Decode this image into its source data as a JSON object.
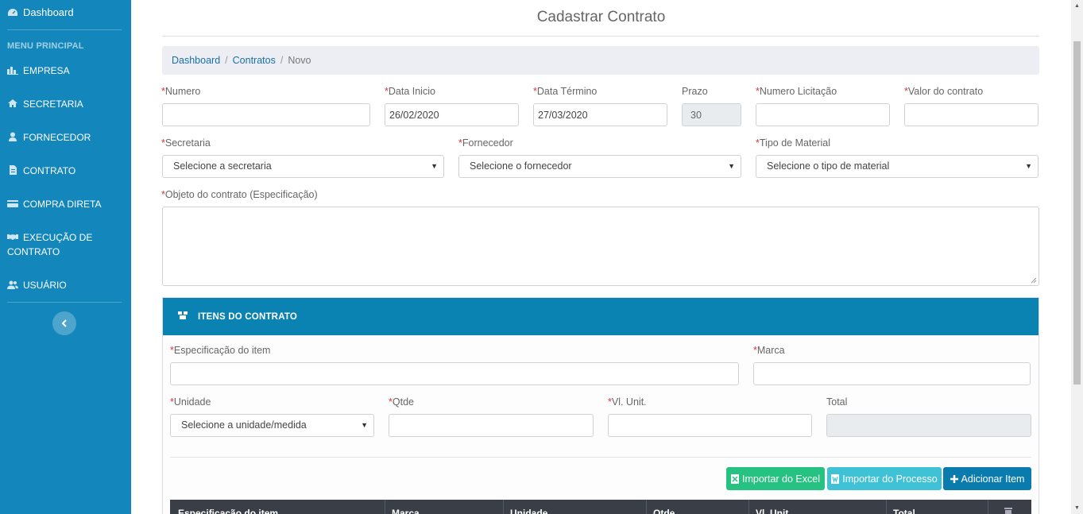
{
  "sidebar": {
    "dashboard": "Dashboard",
    "menu_header": "MENU PRINCIPAL",
    "items": [
      {
        "label": "EMPRESA",
        "icon": "bar-chart-icon"
      },
      {
        "label": "SECRETARIA",
        "icon": "home-icon"
      },
      {
        "label": "FORNECEDOR",
        "icon": "user-icon"
      },
      {
        "label": "CONTRATO",
        "icon": "document-icon"
      },
      {
        "label": "COMPRA DIRETA",
        "icon": "card-icon"
      },
      {
        "label": "EXECUÇÃO DE CONTRATO",
        "icon": "handshake-icon"
      },
      {
        "label": "USUÁRIO",
        "icon": "users-icon"
      }
    ]
  },
  "page": {
    "title": "Cadastrar Contrato"
  },
  "breadcrumb": {
    "dashboard": "Dashboard",
    "sep1": "/",
    "contratos": "Contratos",
    "sep2": "/",
    "current": "Novo"
  },
  "form": {
    "required_mark": "*",
    "numero": {
      "label": "Numero",
      "value": ""
    },
    "data_inicio": {
      "label": "Data Inicio",
      "value": "26/02/2020"
    },
    "data_termino": {
      "label": "Data Término",
      "value": "27/03/2020"
    },
    "prazo": {
      "label": "Prazo",
      "value": "30"
    },
    "numero_licitacao": {
      "label": "Numero Licitação",
      "value": ""
    },
    "valor_contrato": {
      "label": "Valor do contrato",
      "value": ""
    },
    "secretaria": {
      "label": "Secretaria",
      "selected": "Selecione a secretaria"
    },
    "fornecedor": {
      "label": "Fornecedor",
      "selected": "Selecione o fornecedor"
    },
    "tipo_material": {
      "label": "Tipo de Material",
      "selected": "Selecione o tipo de material"
    },
    "objeto": {
      "label": "Objeto do contrato (Especificação)",
      "value": ""
    }
  },
  "itens": {
    "header": "ITENS DO CONTRATO",
    "especificacao": {
      "label": "Especificação do item",
      "value": ""
    },
    "marca": {
      "label": "Marca",
      "value": ""
    },
    "unidade": {
      "label": "Unidade",
      "selected": "Selecione a unidade/medida"
    },
    "qtde": {
      "label": "Qtde",
      "value": ""
    },
    "vl_unit": {
      "label": "Vl. Unit.",
      "value": ""
    },
    "total": {
      "label": "Total",
      "value": ""
    },
    "buttons": {
      "importar_excel": "Importar do Excel",
      "importar_processo": "Importar do Processo",
      "adicionar_item": "Adicionar Item"
    },
    "table_headers": [
      "Especificação do item",
      "Marca",
      "Unidade",
      "Qtde",
      "Vl. Unit.",
      "Total"
    ]
  },
  "colors": {
    "sidebar_bg": "#1387bb",
    "panel_header_bg": "#0a82b2",
    "btn_excel": "#26c281",
    "btn_processo": "#3fc2d6",
    "btn_adicionar": "#0a7bad",
    "required": "#d9333f"
  }
}
